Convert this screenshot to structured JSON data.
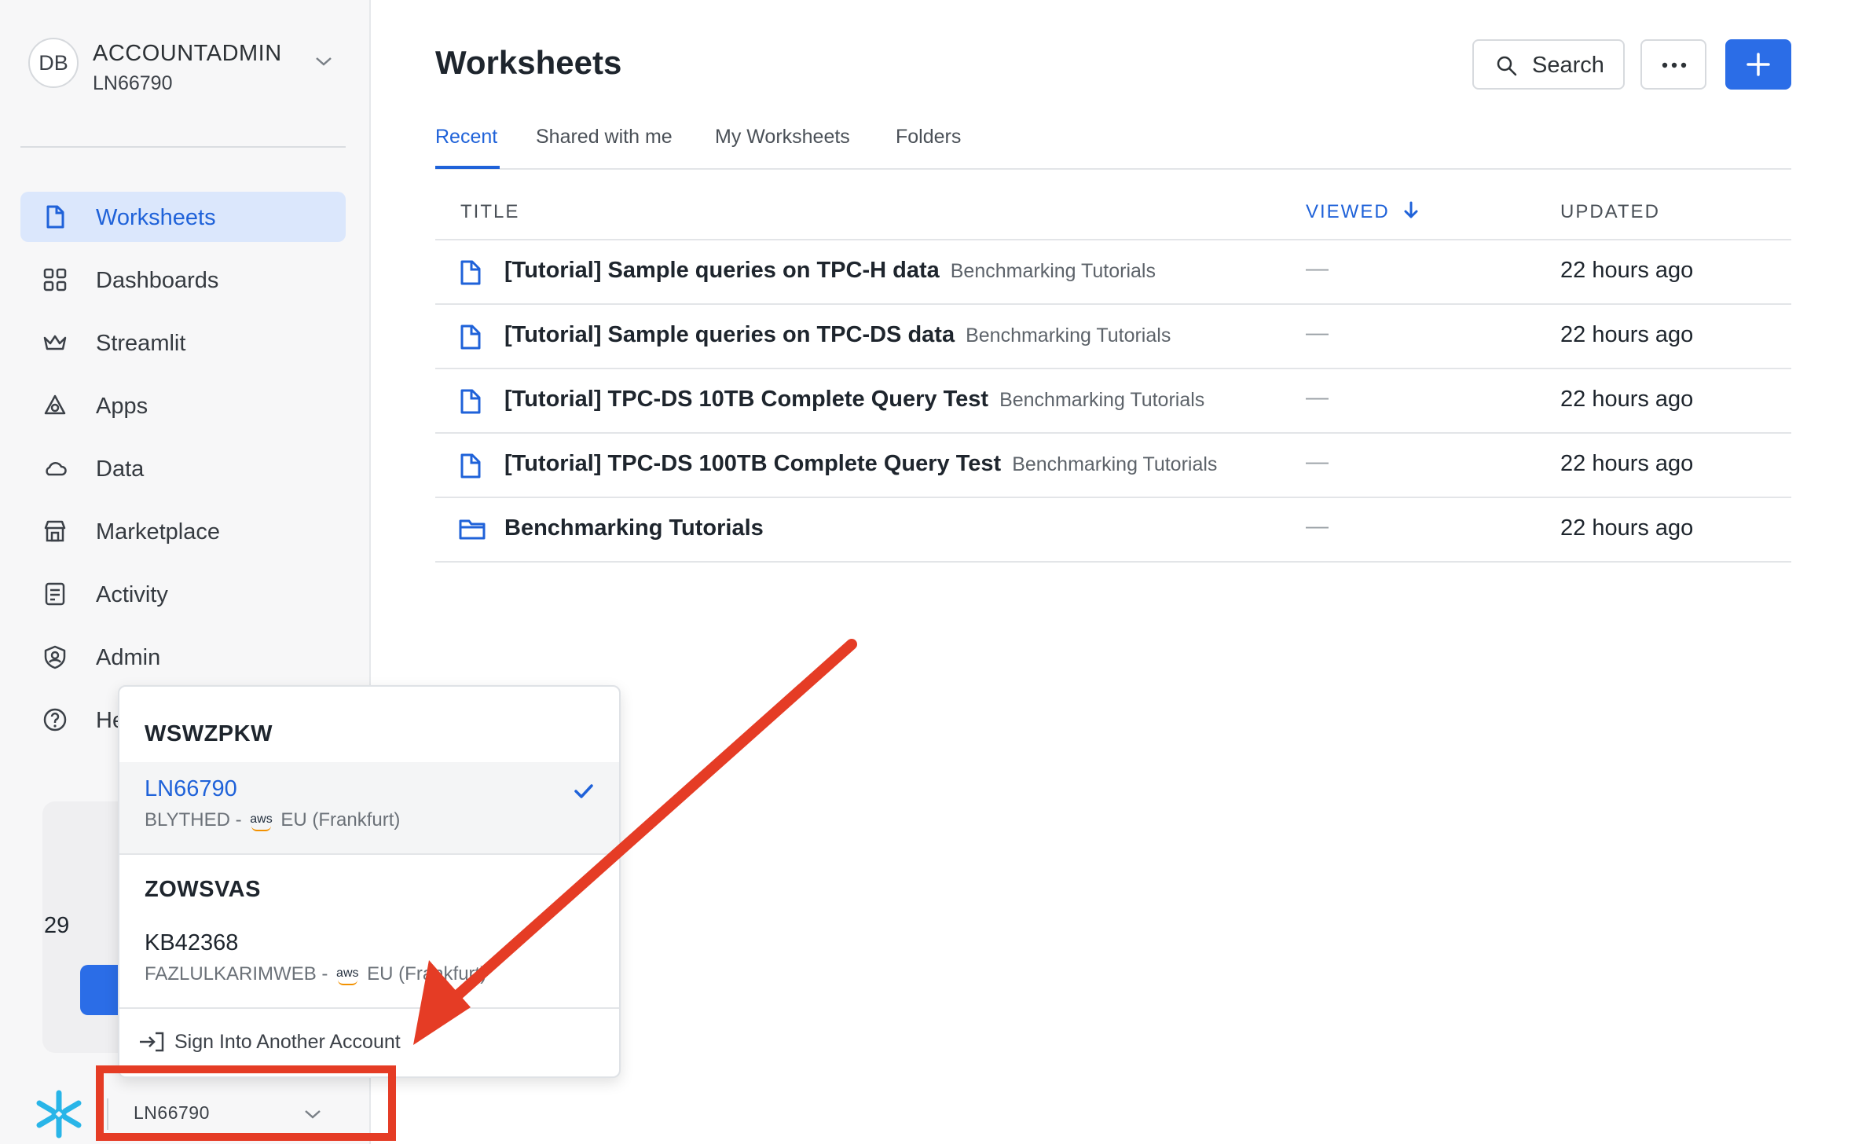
{
  "account": {
    "avatar_initials": "DB",
    "role": "ACCOUNTADMIN",
    "id": "LN66790"
  },
  "nav": [
    {
      "label": "Worksheets",
      "icon": "file-icon",
      "active": true
    },
    {
      "label": "Dashboards",
      "icon": "grid-icon"
    },
    {
      "label": "Streamlit",
      "icon": "crown-icon"
    },
    {
      "label": "Apps",
      "icon": "apps-icon"
    },
    {
      "label": "Data",
      "icon": "cloud-icon"
    },
    {
      "label": "Marketplace",
      "icon": "store-icon"
    },
    {
      "label": "Activity",
      "icon": "list-icon"
    },
    {
      "label": "Admin",
      "icon": "shield-icon"
    },
    {
      "label": "He",
      "icon": "help-icon"
    }
  ],
  "promo": {
    "number": "29"
  },
  "footer": {
    "account": "LN66790"
  },
  "page": {
    "title": "Worksheets",
    "search_label": "Search",
    "add_color": "#2b6de7"
  },
  "tabs": [
    "Recent",
    "Shared with me",
    "My Worksheets",
    "Folders"
  ],
  "table": {
    "columns": {
      "title": "TITLE",
      "viewed": "VIEWED",
      "updated": "UPDATED"
    },
    "rows": [
      {
        "title": "[Tutorial] Sample queries on TPC-H data",
        "folder": "Benchmarking Tutorials",
        "viewed": "—",
        "updated": "22 hours ago",
        "type": "worksheet"
      },
      {
        "title": "[Tutorial] Sample queries on TPC-DS data",
        "folder": "Benchmarking Tutorials",
        "viewed": "—",
        "updated": "22 hours ago",
        "type": "worksheet"
      },
      {
        "title": "[Tutorial] TPC-DS 10TB Complete Query Test",
        "folder": "Benchmarking Tutorials",
        "viewed": "—",
        "updated": "22 hours ago",
        "type": "worksheet"
      },
      {
        "title": "[Tutorial] TPC-DS 100TB Complete Query Test",
        "folder": "Benchmarking Tutorials",
        "viewed": "—",
        "updated": "22 hours ago",
        "type": "worksheet"
      },
      {
        "title": "Benchmarking Tutorials",
        "folder": "",
        "viewed": "—",
        "updated": "22 hours ago",
        "type": "folder"
      }
    ]
  },
  "account_menu": {
    "orgs": [
      {
        "name": "WSWZPKW",
        "account": "LN66790",
        "user": "BLYTHED - ",
        "cloud": "aws",
        "region": "EU (Frankfurt)",
        "selected": true
      },
      {
        "name": "ZOWSVAS",
        "account": "KB42368",
        "user": "FAZLULKARIMWEB - ",
        "cloud": "aws",
        "region": "EU (Frankfurt)",
        "selected": false
      }
    ],
    "sign_in_label": "Sign Into Another Account"
  },
  "annotation_color": "#e53c25"
}
